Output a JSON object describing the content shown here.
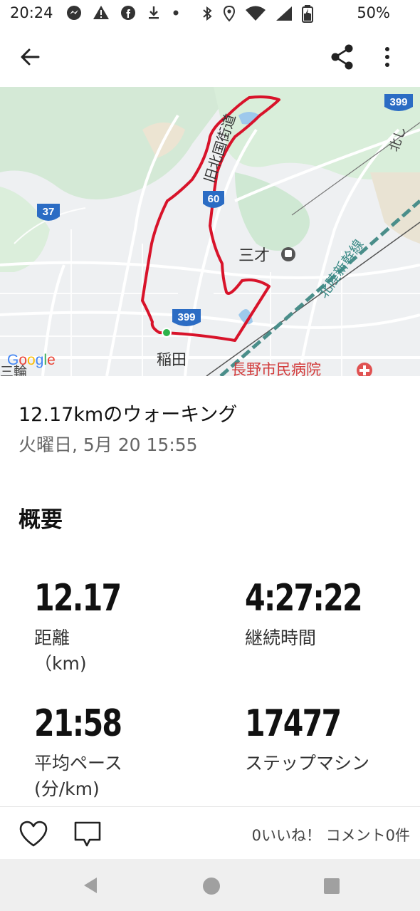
{
  "status_bar": {
    "time": "20:24",
    "battery": "50%",
    "icons": [
      "messenger-icon",
      "alert-icon",
      "facebook-icon",
      "download-icon",
      "dot-icon",
      "bluetooth-icon",
      "location-icon",
      "wifi-icon",
      "signal-icon",
      "battery-icon"
    ]
  },
  "toolbar": {
    "back": "back-arrow-icon",
    "share": "share-icon",
    "more": "more-vert-icon"
  },
  "map": {
    "road_labels": [
      "399",
      "37",
      "60",
      "399",
      "399"
    ],
    "place_labels": [
      "旧北国街道",
      "三才",
      "稲田",
      "北陸新幹線",
      "長野市民病院",
      "北し"
    ],
    "google_logo": "Google",
    "corner_text": "三輪",
    "route_color": "#d8132a",
    "start_marker_color": "#2db34a"
  },
  "activity": {
    "title": "12.17kmのウォーキング",
    "datetime": "火曜日, 5月 20 15:55"
  },
  "overview": {
    "heading": "概要",
    "stats": [
      {
        "value": "12.17",
        "label": "距離",
        "unit": "（km)"
      },
      {
        "value": "4:27:22",
        "label": "継続時間",
        "unit": ""
      },
      {
        "value": "21:58",
        "label": "平均ペース",
        "unit": "(分/km)"
      },
      {
        "value": "17477",
        "label": "ステップマシン",
        "unit": ""
      }
    ]
  },
  "social": {
    "counts": "0いいね！ コメント0件"
  },
  "colors": {
    "route": "#d8132a",
    "map_bg": "#eef0f2",
    "green_area": "#cde9d2"
  }
}
